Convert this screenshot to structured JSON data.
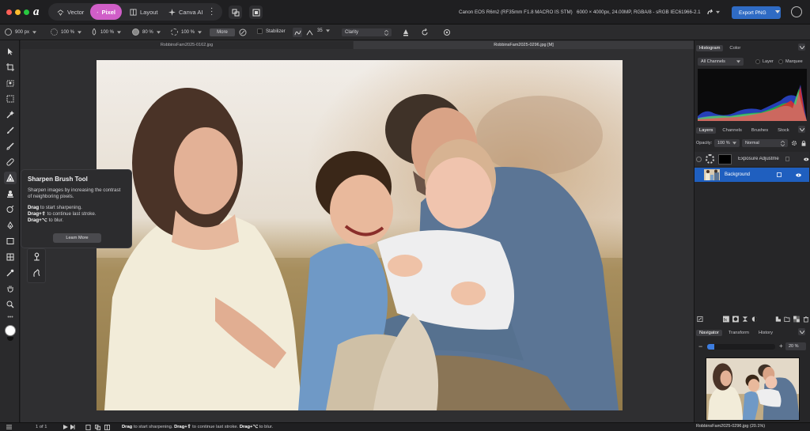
{
  "titlebar": {
    "personas": [
      {
        "label": "Vector",
        "icon": "vector-persona-icon"
      },
      {
        "label": "Pixel",
        "icon": "pixel-persona-icon",
        "active": true
      },
      {
        "label": "Layout",
        "icon": "layout-persona-icon"
      },
      {
        "label": "Canva AI",
        "icon": "canva-ai-icon"
      }
    ],
    "camera_info": "Canon EOS R6m2 (RF35mm F1.8 MACRO IS STM)",
    "image_info": "6000 × 4000px, 24.00MP, RGBA/8 - sRGB IEC61966-2.1",
    "export_label": "Export PNG",
    "accent_color": "#d05ec8",
    "export_color": "#2f6bc4"
  },
  "context_toolbar": {
    "width": "900 px",
    "opacity": "100 %",
    "flow": "100 %",
    "hardness": "80 %",
    "strength": "100 %",
    "more_label": "More",
    "stabilizer_label": "Stabilizer",
    "stabilizer_value": "35",
    "mode": "Clarity"
  },
  "documents": {
    "tabs": [
      "RobbinsFam2025-0162.jpg",
      "RobbinsFam2025-0296.jpg [M]"
    ]
  },
  "tooltip": {
    "title": "Sharpen Brush Tool",
    "description": "Sharpen images by increasing the contrast of neighboring pixels.",
    "line1_key": "Drag",
    "line1_text": "to start sharpening.",
    "line2_key": "Drag+⇧",
    "line2_text": "to continue last stroke.",
    "line3_key": "Drag+⌥",
    "line3_text": "to blur.",
    "learn_more": "Learn More"
  },
  "histogram_panel": {
    "tabs": [
      "Histogram",
      "Color"
    ],
    "channels": "All Channels",
    "options": [
      "Layer",
      "Marquee"
    ]
  },
  "layers_panel": {
    "tabs": [
      "Layers",
      "Channels",
      "Brushes",
      "Stock"
    ],
    "opacity_label": "Opacity:",
    "opacity_value": "100 %",
    "blend_mode": "Normal",
    "layers": [
      {
        "name": "Exposure Adjustme",
        "selected": false
      },
      {
        "name": "Background",
        "selected": true
      }
    ],
    "selection_color": "#1f5fbf"
  },
  "navigator_panel": {
    "tabs": [
      "Navigator",
      "Transform",
      "History"
    ],
    "zoom": "20 %",
    "zoom_fraction": 0.2,
    "caption": "RobbinsFam2025-0296.jpg (20.1%)"
  },
  "statusbar": {
    "page": "1 of 1",
    "hint_key1": "Drag",
    "hint_text1": "to start sharpening.",
    "hint_key2": "Drag+⇧",
    "hint_text2": "to continue last stroke.",
    "hint_key3": "Drag+⌥",
    "hint_text3": "to blur."
  }
}
